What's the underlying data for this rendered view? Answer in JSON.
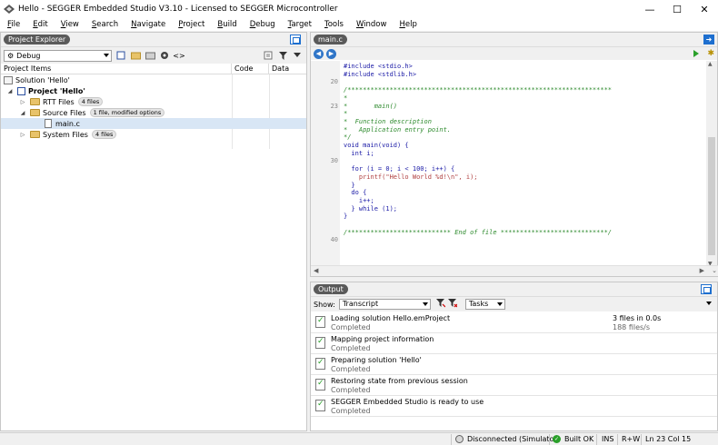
{
  "window": {
    "title": "Hello - SEGGER Embedded Studio V3.10 - Licensed to SEGGER Microcontroller",
    "minimize": "—",
    "maximize": "☐",
    "close": "✕"
  },
  "menu": [
    "File",
    "Edit",
    "View",
    "Search",
    "Navigate",
    "Project",
    "Build",
    "Debug",
    "Target",
    "Tools",
    "Window",
    "Help"
  ],
  "project_explorer": {
    "tab": "Project Explorer",
    "config": "Debug",
    "columns": {
      "items": "Project Items",
      "code": "Code",
      "data": "Data"
    },
    "tree": {
      "solution": "Solution 'Hello'",
      "project": "Project 'Hello'",
      "rtt": {
        "label": "RTT Files",
        "badge": "4 files"
      },
      "source": {
        "label": "Source Files",
        "badge": "1 file, modified options"
      },
      "file": "main.c",
      "system": {
        "label": "System Files",
        "badge": "4 files"
      }
    }
  },
  "editor": {
    "tab": "main.c",
    "lines": {
      "l1": "#include <stdio.h>",
      "l2": "#include <stdlib.h>",
      "ln20": "20",
      "l4": "/*********************************************************************",
      "l5": "*",
      "ln23": "23",
      "l6": "*       main()",
      "l7": "*",
      "l8": "*  Function description",
      "l9": "*   Application entry point.",
      "l10": "*/",
      "l11": "void main(void) {",
      "l12": "  int i;",
      "ln30": "30",
      "l14": "  for (i = 0; i < 100; i++) {",
      "l15": "    printf(\"Hello World %d!\\n\", i);",
      "l16": "  }",
      "l17": "  do {",
      "l18": "    i++;",
      "l19": "  } while (1);",
      "l20": "}",
      "l22": "/*************************** End of file ****************************/",
      "ln40": "40"
    }
  },
  "output": {
    "tab": "Output",
    "show_label": "Show:",
    "show_value": "Transcript",
    "tasks_value": "Tasks",
    "messages": [
      {
        "title": "Loading solution Hello.emProject",
        "status": "Completed",
        "right1": "3 files in 0.0s",
        "right2": "188 files/s"
      },
      {
        "title": "Mapping project information",
        "status": "Completed"
      },
      {
        "title": "Preparing solution 'Hello'",
        "status": "Completed"
      },
      {
        "title": "Restoring state from previous session",
        "status": "Completed"
      },
      {
        "title": "SEGGER Embedded Studio is ready to use",
        "status": "Completed"
      }
    ]
  },
  "status": {
    "connection": "Disconnected (Simulator)",
    "build": "Built OK",
    "mode": "INS",
    "access": "R+W",
    "position": "Ln 23 Col 15"
  },
  "colors": {
    "accent": "#1e6fcf",
    "tab_bg": "#5a5a5a",
    "ok_green": "#2aa02a",
    "comment": "#2d8a2d",
    "keyword": "#1a1aa6"
  }
}
